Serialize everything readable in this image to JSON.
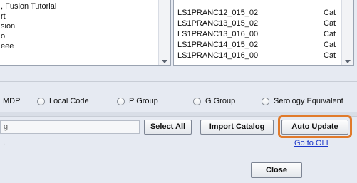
{
  "left_list": {
    "items": [
      ", Fusion Tutorial",
      "rt",
      "sion",
      "o",
      "eee"
    ]
  },
  "catalog_list": {
    "rows": [
      {
        "name": "LS1PRANC12_015_02",
        "type": "Cat"
      },
      {
        "name": "LS1PRANC13_015_02",
        "type": "Cat"
      },
      {
        "name": "LS1PRANC13_016_00",
        "type": "Cat"
      },
      {
        "name": "LS1PRANC14_015_02",
        "type": "Cat"
      },
      {
        "name": "LS1PRANC14_016_00",
        "type": "Cat"
      }
    ]
  },
  "code_options": {
    "mdp_label": "MDP",
    "options": [
      "Local Code",
      "P Group",
      "G Group",
      "Serology Equivalent"
    ]
  },
  "search_field": {
    "value": "g"
  },
  "status_text": ".",
  "buttons": {
    "select_all": "Select All",
    "import_catalog": "Import Catalog",
    "auto_update": "Auto Update",
    "close": "Close"
  },
  "links": {
    "go_to_oli": "Go to OLI"
  },
  "colors": {
    "highlight": "#e07a2b",
    "link": "#1a35c8"
  }
}
